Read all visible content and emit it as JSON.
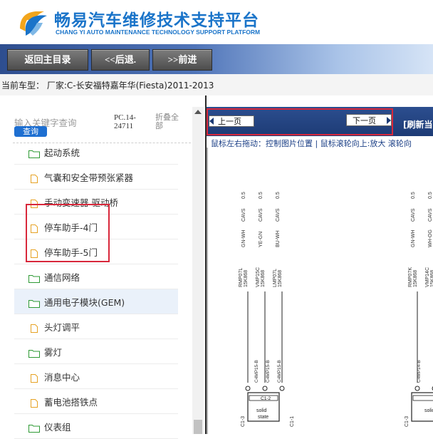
{
  "header": {
    "title_cn": "畅易汽车维修技术支持平台",
    "title_en": "CHANG YI AUTO MAINTENANCE TECHNOLOGY SUPPORT PLATFORM",
    "brand_color": "#1a74c9"
  },
  "nav": {
    "home": "返回主目录",
    "back": "<<后退.",
    "forward": ">>前进"
  },
  "model": {
    "label": "当前车型：  厂家:C-长安福特嘉年华(Fiesta)2011-2013"
  },
  "sidebar": {
    "search_placeholder": "输入关键字查询",
    "search_button": "查询",
    "pc_code": "PC.14-\n24711",
    "collapse_all": "折叠全\n部",
    "items": [
      {
        "label": "起动系统",
        "icon": "folder-icon"
      },
      {
        "label": "气囊和安全带预张紧器",
        "icon": "document-icon"
      },
      {
        "label": "手动变速器  驱动桥",
        "icon": "document-icon"
      },
      {
        "label": "停车助手-4门",
        "icon": "document-icon"
      },
      {
        "label": "停车助手-5门",
        "icon": "document-icon"
      },
      {
        "label": "通信网络",
        "icon": "folder-icon"
      },
      {
        "label": "通用电子模块(GEM)",
        "icon": "folder-icon"
      },
      {
        "label": "头灯调平",
        "icon": "document-icon"
      },
      {
        "label": "雾灯",
        "icon": "folder-icon"
      },
      {
        "label": "消息中心",
        "icon": "document-icon"
      },
      {
        "label": "蓄电池搭铁点",
        "icon": "document-icon"
      },
      {
        "label": "仪表组",
        "icon": "folder-icon"
      }
    ]
  },
  "viewer": {
    "prev_page": "上一页",
    "next_page": "下一页",
    "refresh": "[刷新当",
    "hint": "鼠标左右拖动：控制图片位置 | 鼠标滚轮向上:放大  滚轮向",
    "wire_labels": [
      "0.5",
      "CAVS",
      "GN-WH",
      "RMP07L\n15K868",
      "0.5",
      "CAVS",
      "YE-GN",
      "VMP15C\n15K868",
      "0.5",
      "CAVS",
      "BU-WH",
      "LMP07L\n15K868",
      "0.5",
      "CAVS",
      "GN-WH",
      "RMP07K\n15K868",
      "0.5",
      "CAVS",
      "WH-OG",
      "VMP14C\n15K868"
    ],
    "connector_labels": [
      "C4MP15-B",
      "C4MP15-B",
      "C4MP15-B",
      "C4MP14-B"
    ],
    "sensor_labels": [
      "C1-3",
      "C1-2",
      "C1-1",
      "solid",
      "state"
    ]
  }
}
